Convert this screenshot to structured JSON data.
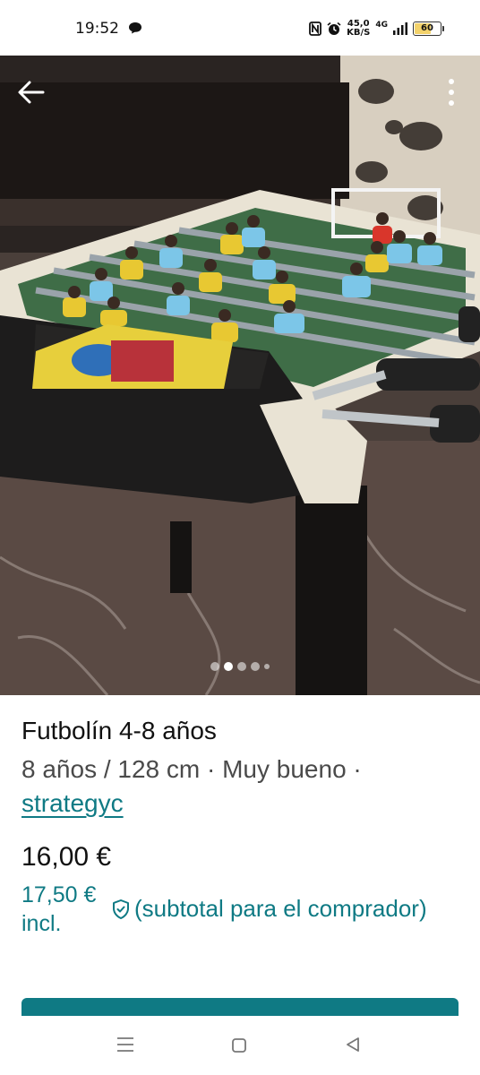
{
  "status_bar": {
    "time": "19:52",
    "speed_value": "45,0",
    "speed_unit": "KB/S",
    "network": "4G",
    "battery": "60"
  },
  "gallery": {
    "image_count": 5,
    "active_index": 1,
    "back_icon": "arrow-left-icon",
    "more_icon": "more-vertical-icon"
  },
  "item": {
    "title": "Futbolín 4-8 años",
    "details": "8 años / 128 cm · Muy bueno ·",
    "seller": "strategyc",
    "price": "16,00 €",
    "price_incl": "17,50 € incl.",
    "incl_note": "(subtotal para el comprador)"
  },
  "colors": {
    "accent": "#0f7a84"
  },
  "nav": {
    "icons": [
      "menu-icon",
      "home-icon",
      "back-icon"
    ]
  }
}
